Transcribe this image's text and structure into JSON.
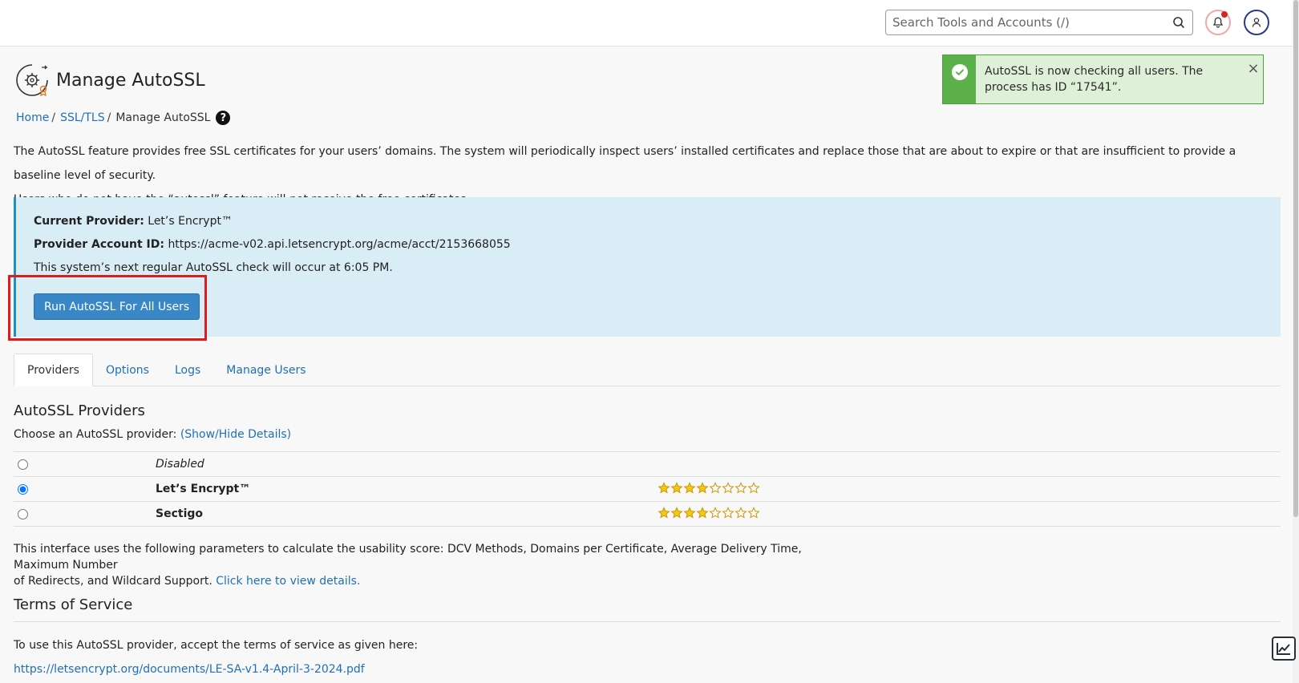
{
  "topbar": {
    "search_placeholder": "Search Tools and Accounts (/)"
  },
  "header": {
    "title": "Manage AutoSSL"
  },
  "breadcrumb": {
    "items": [
      "Home",
      "SSL/TLS",
      "Manage AutoSSL"
    ]
  },
  "toast": {
    "message": "AutoSSL is now checking all users. The process has ID “17541”.",
    "close": "×"
  },
  "description": {
    "line1": "The AutoSSL feature provides free SSL certificates for your users’ domains. The system will periodically inspect users’ installed certificates and replace those that are about to expire or that are insufficient to provide a baseline level of security.",
    "line2": "Users who do not have the “autossl” feature will not receive the free certificates."
  },
  "info": {
    "provider_label": "Current Provider:",
    "provider_value": "Let’s Encrypt™",
    "account_label": "Provider Account ID:",
    "account_value": "https://acme-v02.api.letsencrypt.org/acme/acct/2153668055",
    "next_check": "This system’s next regular AutoSSL check will occur at 6:05 PM.",
    "run_button": "Run AutoSSL For All Users"
  },
  "tabs": [
    "Providers",
    "Options",
    "Logs",
    "Manage Users"
  ],
  "providers": {
    "title": "AutoSSL Providers",
    "choose_label": "Choose an AutoSSL provider:",
    "toggle_link": "(Show/Hide Details)",
    "rows": [
      {
        "name": "Disabled",
        "selected": false,
        "rating": null
      },
      {
        "name": "Let’s Encrypt™",
        "selected": true,
        "rating": 4
      },
      {
        "name": "Sectigo",
        "selected": false,
        "rating": 4
      }
    ],
    "rating_max": 8,
    "usability_text_1": "This interface uses the following parameters to calculate the usability score: DCV Methods, Domains per Certificate, Average Delivery Time, Maximum Number",
    "usability_text_2": "of Redirects, and Wildcard Support.",
    "usability_link": "Click here to view details."
  },
  "tos": {
    "title": "Terms of Service",
    "text": "To use this AutoSSL provider, accept the terms of service as given here:",
    "link": "https://letsencrypt.org/documents/LE-SA-v1.4-April-3-2024.pdf"
  },
  "colors": {
    "link": "#1f6fb8",
    "info_bg": "#d9edf7",
    "button": "#3a87c7",
    "success": "#5cb14a",
    "star": "#f5c518",
    "highlight": "#e01b1b"
  }
}
